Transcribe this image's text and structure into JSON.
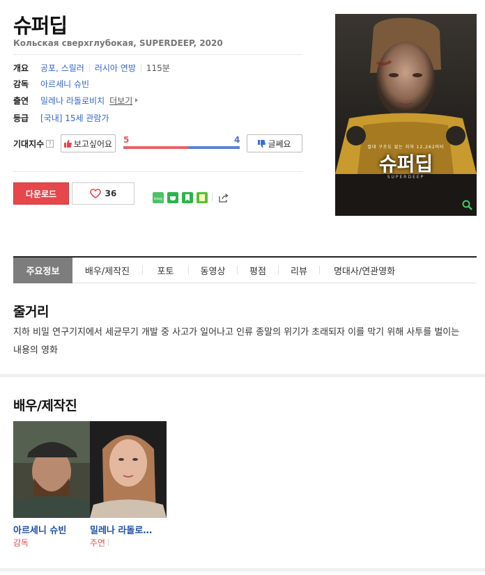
{
  "movie": {
    "title": "슈퍼딥",
    "subtitle": "Кольская сверхглубокая, SUPERDEEP, 2020"
  },
  "info": {
    "overview_label": "개요",
    "genre": "공포, 스릴러",
    "country": "러시아 연방",
    "runtime": "115분",
    "director_label": "감독",
    "director": "아르세니 슈빈",
    "cast_label": "출연",
    "cast": "밀레나 라돌로비치",
    "more_label": "더보기",
    "rating_label": "등급",
    "rating": "[국내] 15세 관람가"
  },
  "expectation": {
    "label": "기대지수",
    "help": "?",
    "want_label": "보고싶어요",
    "dislike_label": "글쎄요",
    "want_count": "5",
    "dislike_count": "4",
    "want_ratio": 0.555
  },
  "actions": {
    "download_label": "다운로드",
    "like_count": "36",
    "share_icons": [
      "blog-icon",
      "cafe-icon",
      "bookmark-icon",
      "memo-icon",
      "share-icon"
    ]
  },
  "poster": {
    "tagline": "절대 구조도 없는 지하 12,262미터",
    "title": "슈퍼딥",
    "title_en": "SUPERDEEP",
    "zoom_icon": "magnifier-icon"
  },
  "tabs": [
    "주요정보",
    "배우/제작진",
    "포토",
    "동영상",
    "평점",
    "리뷰",
    "명대사/연관영화"
  ],
  "synopsis": {
    "title": "줄거리",
    "text": "지하 비밀 연구기지에서 세균무기 개발 중 사고가 일어나고 인류 종말의 위기가 초래되자 이를 막기 위해 사투를 벌이는 내용의 영화"
  },
  "crew": {
    "title": "배우/제작진",
    "people": [
      {
        "name": "아르세니 슈빈",
        "role": "감독"
      },
      {
        "name": "밀레나 라돌로…",
        "role": "주연"
      }
    ]
  },
  "colors": {
    "accent_red": "#e6474b",
    "link_blue": "#3366cc",
    "bar_red": "#e86266",
    "bar_blue": "#5b83d6",
    "tab_active": "#7d7d7d"
  }
}
